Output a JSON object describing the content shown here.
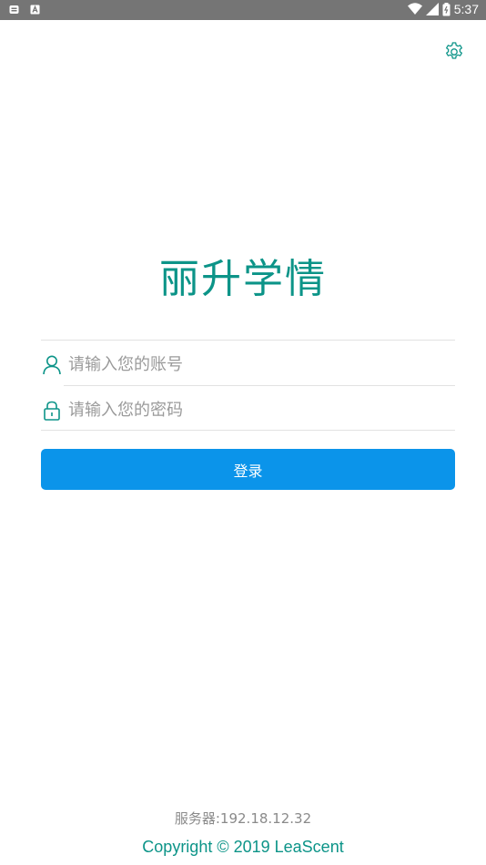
{
  "status_bar": {
    "time": "5:37",
    "icons": [
      "notification-icon",
      "a-icon",
      "wifi-icon",
      "cell-signal-icon",
      "battery-icon"
    ]
  },
  "settings": {
    "icon": "gear-icon"
  },
  "app": {
    "title": "丽升学情"
  },
  "login_form": {
    "account_placeholder": "请输入您的账号",
    "account_value": "",
    "password_placeholder": "请输入您的密码",
    "password_value": "",
    "login_label": "登录"
  },
  "footer": {
    "server": "服务器:192.18.12.32",
    "copyright": "Copyright © 2019 LeaScent"
  },
  "colors": {
    "accent": "#0c9488",
    "button": "#0b94ea",
    "status_bar": "#757575"
  }
}
